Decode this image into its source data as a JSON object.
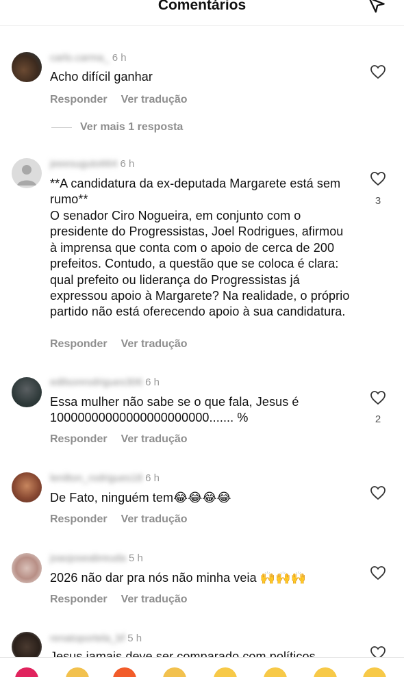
{
  "header": {
    "title": "Comentários"
  },
  "labels": {
    "reply": "Responder",
    "translate": "Ver tradução",
    "more_replies": "Ver mais 1 resposta"
  },
  "comments": [
    {
      "username": "carlo.carma_",
      "time": "6 h",
      "text": "Acho difícil ganhar",
      "likes": ""
    },
    {
      "username": "jeeesuguto664",
      "time": "6 h",
      "title": "**A candidatura da ex-deputada Margarete está sem rumo**",
      "text": "O senador Ciro Nogueira, em conjunto com o presidente do Progressistas, Joel Rodrigues, afirmou à imprensa que conta com o apoio de cerca de 200 prefeitos. Contudo, a questão que se coloca é clara: qual prefeito ou liderança do Progressistas já expressou apoio à Margarete? Na realidade, o próprio partido não está oferecendo apoio à sua candidatura.",
      "likes": "3"
    },
    {
      "username": "edilsonrodrigues306",
      "time": "6 h",
      "text": "Essa mulher não sabe se o que fala, Jesus é 10000000000000000000000....... %",
      "likes": "2"
    },
    {
      "username": "lenilton_rodrigues18",
      "time": "6 h",
      "text": "De Fato, ninguém tem😂😂😂😂",
      "likes": ""
    },
    {
      "username": "joaojoseabreuda",
      "time": "5 h",
      "text": "2026 não dar pra nós não minha veia 🙌🙌🙌",
      "likes": ""
    },
    {
      "username": "renatoportela_bf",
      "time": "5 h",
      "text": "Jesus jamais deve ser comparado com políticos",
      "likes": ""
    }
  ],
  "emoji_bar": [
    "heart",
    "raising-hands",
    "fire",
    "clapping",
    "crying-face",
    "heart-eyes",
    "surprised-face",
    "laughing-face"
  ],
  "colors": {
    "muted": "#8e8e8e",
    "text": "#111111",
    "divider": "#efefef"
  }
}
